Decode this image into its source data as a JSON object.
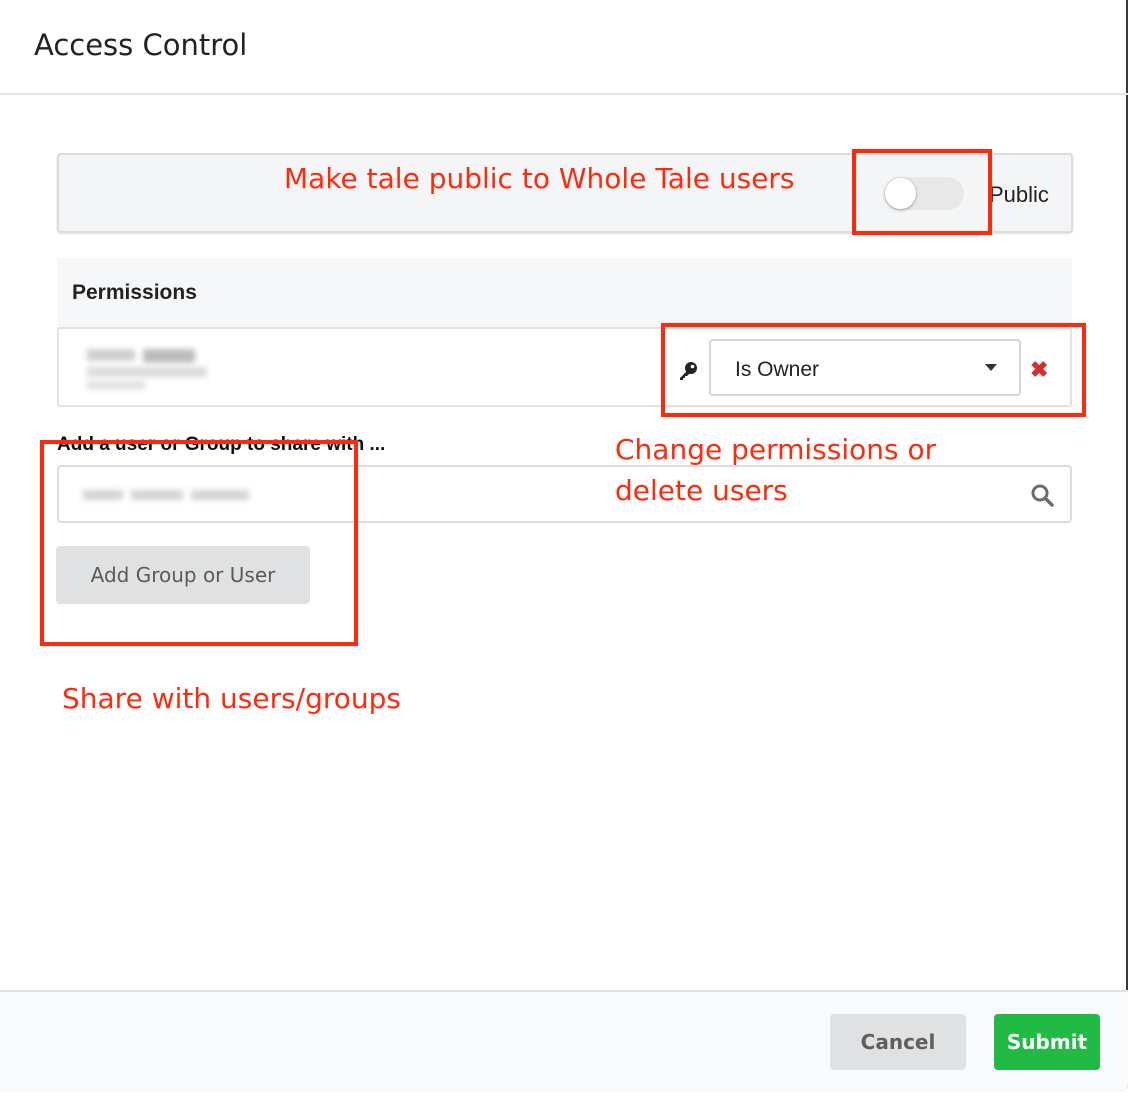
{
  "modal": {
    "title": "Access Control"
  },
  "public_panel": {
    "toggle_label": "Public",
    "toggle_on": false
  },
  "permissions": {
    "title": "Permissions",
    "rows": [
      {
        "role": "Is Owner"
      }
    ]
  },
  "share": {
    "label": "Add a user or Group to share with ...",
    "add_button": "Add Group or User"
  },
  "footer": {
    "cancel_label": "Cancel",
    "submit_label": "Submit"
  },
  "annotations": {
    "public_note": "Make tale public to Whole Tale users",
    "permissions_note_line1": "Change permissions or",
    "permissions_note_line2": "delete users",
    "share_note": "Share with users/groups"
  },
  "colors": {
    "annotation": "#ff2a0c",
    "submit": "#21ba45",
    "remove": "#d32f2f"
  },
  "icons": [
    "key-icon",
    "chevron-down-icon",
    "remove-icon",
    "search-icon"
  ]
}
